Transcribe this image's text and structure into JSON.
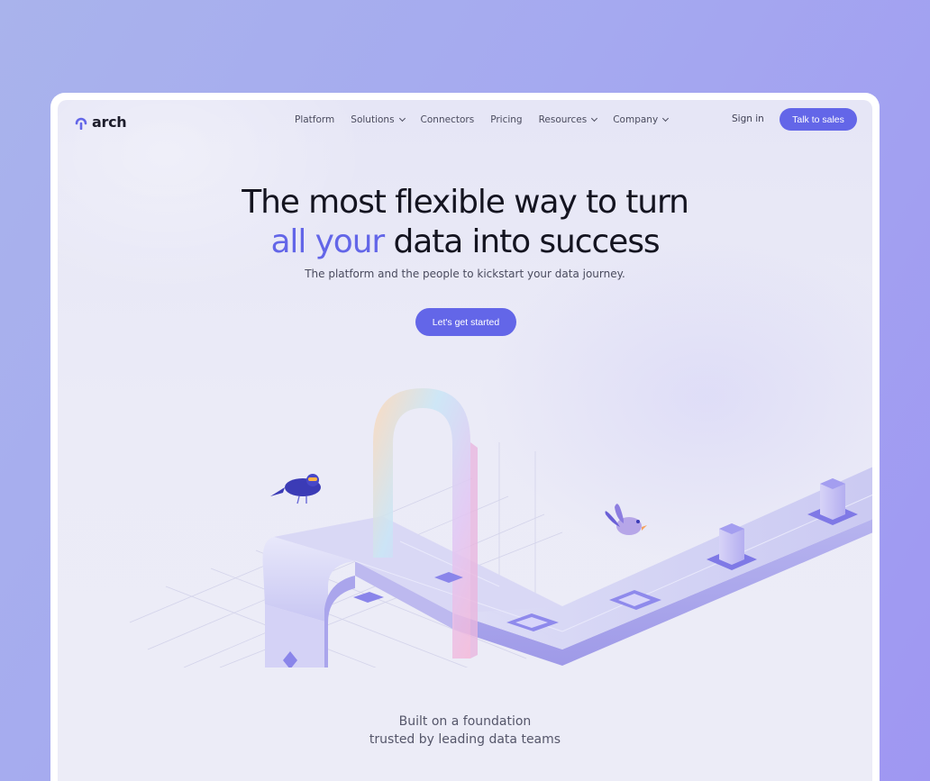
{
  "brand": {
    "name": "arch",
    "accent_color": "#6366e8",
    "logo_icon": "arch-logo-icon"
  },
  "nav": {
    "items": [
      {
        "label": "Platform",
        "has_dropdown": false
      },
      {
        "label": "Solutions",
        "has_dropdown": true
      },
      {
        "label": "Connectors",
        "has_dropdown": false
      },
      {
        "label": "Pricing",
        "has_dropdown": false
      },
      {
        "label": "Resources",
        "has_dropdown": true
      },
      {
        "label": "Company",
        "has_dropdown": true
      }
    ],
    "sign_in": "Sign in",
    "cta": "Talk to sales"
  },
  "hero": {
    "title_line1": "The most flexible way to turn",
    "title_accent": "all your",
    "title_line2_rest": "data into success",
    "subtitle": "The platform and the people to kickstart your data journey.",
    "cta": "Let's get started"
  },
  "illustration": {
    "icon": "data-pipeline-illustration",
    "elements": [
      "arch-gate-icon",
      "bird-icon",
      "pipeline-track",
      "data-block-icon"
    ]
  },
  "foundation": {
    "line1": "Built on a foundation",
    "line2": "trusted by leading data teams"
  }
}
